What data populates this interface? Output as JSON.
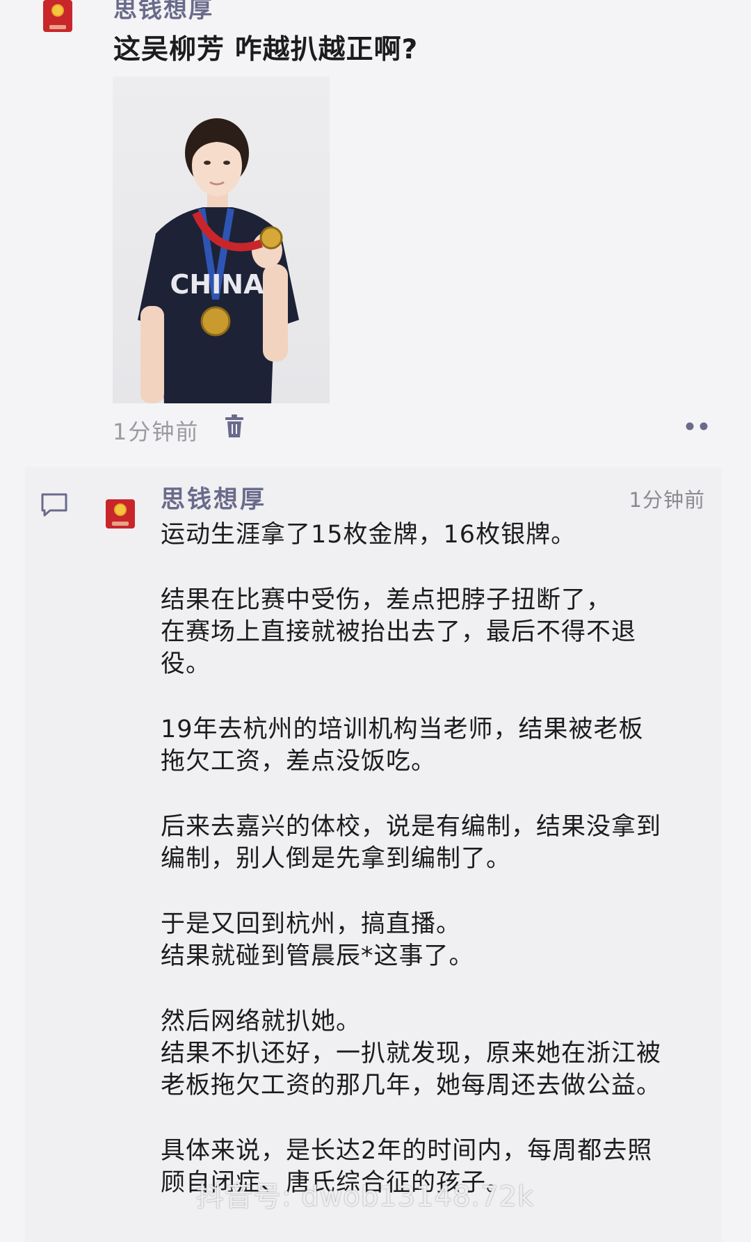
{
  "post": {
    "author": "思钱想厚",
    "text": "这吴柳芳 咋越扒越正啊?",
    "photo_shirt_text": "CHINA",
    "time": "1分钟前"
  },
  "comment": {
    "author": "思钱想厚",
    "time": "1分钟前",
    "paragraphs": [
      "运动生涯拿了15枚金牌，16枚银牌。",
      "结果在比赛中受伤，差点把脖子扭断了，\n在赛场上直接就被抬出去了，最后不得不退\n役。",
      "19年去杭州的培训机构当老师，结果被老板\n拖欠工资，差点没饭吃。",
      "后来去嘉兴的体校，说是有编制，结果没拿到\n编制，别人倒是先拿到编制了。",
      "于是又回到杭州，搞直播。\n结果就碰到管晨辰*这事了。",
      "然后网络就扒她。\n结果不扒还好，一扒就发现，原来她在浙江被\n老板拖欠工资的那几年，她每周还去做公益。",
      "具体来说，是长达2年的时间内，每周都去照\n顾自闭症、唐氏综合征的孩子。"
    ]
  },
  "watermark": "抖音号: dwob13148.72k",
  "colors": {
    "background": "#f4f4f6",
    "author_name": "#6a6a8c",
    "timestamp": "#9a9aa2",
    "avatar_red": "#c8262b"
  },
  "icons": {
    "delete": "trash-icon",
    "more": "more-dots-icon",
    "comment": "comment-bubble-icon"
  }
}
